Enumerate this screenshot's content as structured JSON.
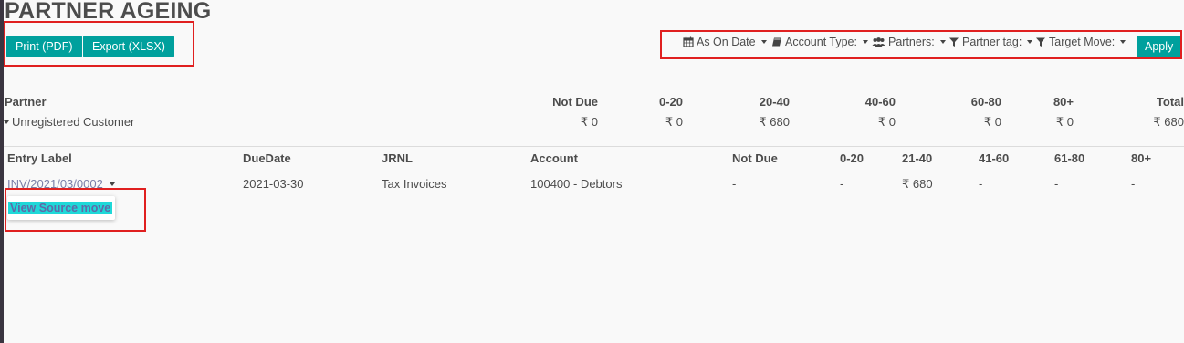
{
  "page": {
    "title": "PARTNER AGEING"
  },
  "actions": {
    "print_label": "Print (PDF)",
    "export_label": "Export (XLSX)"
  },
  "filters": {
    "as_on_date": "As On Date",
    "account_type": "Account Type:",
    "partners": "Partners:",
    "partner_tag": "Partner tag:",
    "target_move": "Target Move:",
    "apply_label": "Apply"
  },
  "summary": {
    "headers": {
      "partner": "Partner",
      "not_due": "Not Due",
      "b0_20": "0-20",
      "b20_40": "20-40",
      "b40_60": "40-60",
      "b60_80": "60-80",
      "b80p": "80+",
      "total": "Total"
    },
    "row": {
      "partner": "Unregistered Customer",
      "not_due": "₹ 0",
      "b0_20": "₹ 0",
      "b20_40": "₹ 680",
      "b40_60": "₹ 0",
      "b60_80": "₹ 0",
      "b80p": "₹ 0",
      "total": "₹ 680"
    }
  },
  "detail": {
    "headers": {
      "entry_label": "Entry Label",
      "due_date": "DueDate",
      "jrnl": "JRNL",
      "account": "Account",
      "not_due": "Not Due",
      "b0_20": "0-20",
      "b21_40": "21-40",
      "b41_60": "41-60",
      "b61_80": "61-80",
      "b80p": "80+"
    },
    "row": {
      "entry_label": "INV/2021/03/0002",
      "due_date": "2021-03-30",
      "jrnl": "Tax Invoices",
      "account": "100400 - Debtors",
      "not_due": "-",
      "b0_20": "-",
      "b21_40": "₹ 680",
      "b41_60": "-",
      "b61_80": "-",
      "b80p": "-"
    },
    "menu": {
      "view_source_move": "View Source move"
    }
  },
  "colors": {
    "accent": "#00a09d",
    "annotation": "#e02020",
    "highlight": "#1fd8d8"
  },
  "icons": [
    "calendar-icon",
    "book-icon",
    "users-icon",
    "filter-icon"
  ]
}
